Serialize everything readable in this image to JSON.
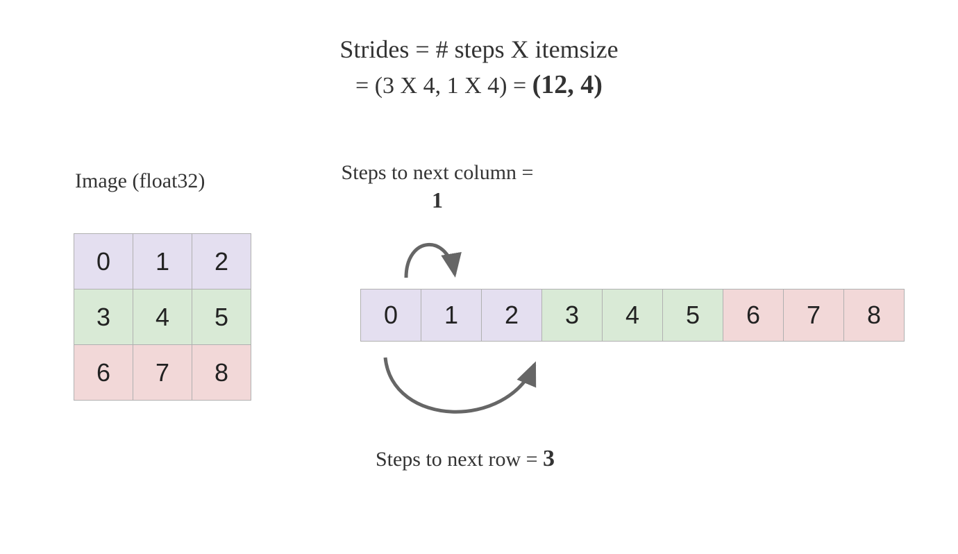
{
  "title_line1": "Strides = # steps X itemsize",
  "title_line2_prefix": "= (3 X 4, 1 X 4) = ",
  "title_line2_result": "(12, 4)",
  "image_label": "Image (float32)",
  "steps_col_text": "Steps to next column = ",
  "steps_col_value": "1",
  "steps_row_text": "Steps to next row = ",
  "steps_row_value": "3",
  "matrix": [
    [
      "0",
      "1",
      "2"
    ],
    [
      "3",
      "4",
      "5"
    ],
    [
      "6",
      "7",
      "8"
    ]
  ],
  "flat": [
    "0",
    "1",
    "2",
    "3",
    "4",
    "5",
    "6",
    "7",
    "8"
  ],
  "colors": {
    "row0": "#e4dff0",
    "row1": "#d9ead6",
    "row2": "#f2d8d8"
  }
}
